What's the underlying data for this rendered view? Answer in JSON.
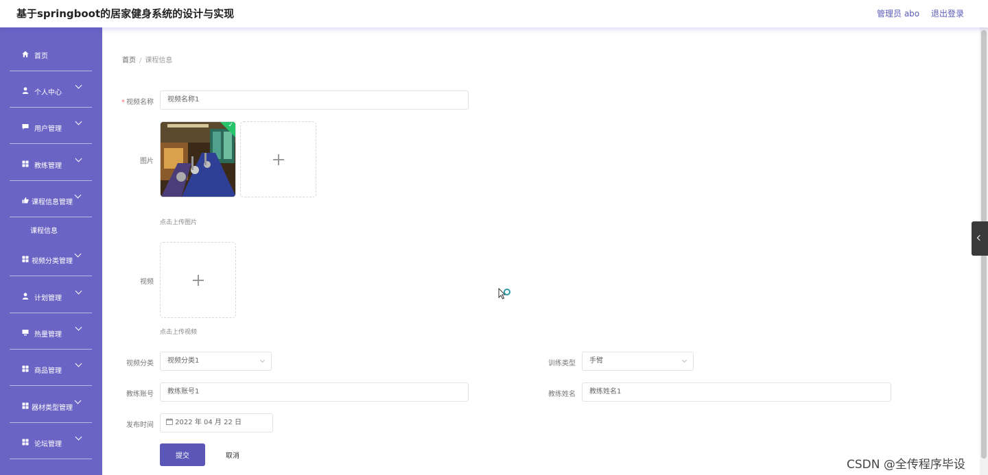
{
  "header": {
    "title": "基于springboot的居家健身系统的设计与实现",
    "user": "管理员 abo",
    "logout": "退出登录"
  },
  "sidebar": {
    "items": [
      {
        "label": "首页",
        "icon": "home-icon"
      },
      {
        "label": "个人中心",
        "icon": "user-icon"
      },
      {
        "label": "用户管理",
        "icon": "chat-icon"
      },
      {
        "label": "教练管理",
        "icon": "grid-icon"
      },
      {
        "label": "课程信息管理",
        "icon": "thumb-icon"
      },
      {
        "label": "视频分类管理",
        "icon": "grid-icon"
      },
      {
        "label": "计划管理",
        "icon": "user-icon"
      },
      {
        "label": "热量管理",
        "icon": "monitor-icon"
      },
      {
        "label": "商品管理",
        "icon": "grid-icon"
      },
      {
        "label": "器材类型管理",
        "icon": "grid-icon"
      },
      {
        "label": "论坛管理",
        "icon": "grid-icon"
      }
    ],
    "subitem": "课程信息"
  },
  "breadcrumb": {
    "home": "首页",
    "sep": "/",
    "current": "课程信息"
  },
  "form": {
    "video_name": {
      "label": "视频名称",
      "value": "视频名称1",
      "required": "*"
    },
    "image": {
      "label": "图片",
      "hint": "点击上传图片"
    },
    "video": {
      "label": "视频",
      "hint": "点击上传视频"
    },
    "category": {
      "label": "视频分类",
      "value": "视频分类1"
    },
    "train_type": {
      "label": "训练类型",
      "value": "手臂"
    },
    "coach_account": {
      "label": "教练账号",
      "value": "教练账号1"
    },
    "coach_name": {
      "label": "教练姓名",
      "value": "教练姓名1"
    },
    "publish_time": {
      "label": "发布时间",
      "value": "2022 年 04 月 22 日"
    },
    "submit": "提交",
    "cancel": "取消"
  },
  "watermark": "CSDN @全传程序毕设",
  "colors": {
    "sidebar": "#6a64c4",
    "primary": "#5b57b8",
    "required": "#f56c6c",
    "success": "#27c46b"
  }
}
